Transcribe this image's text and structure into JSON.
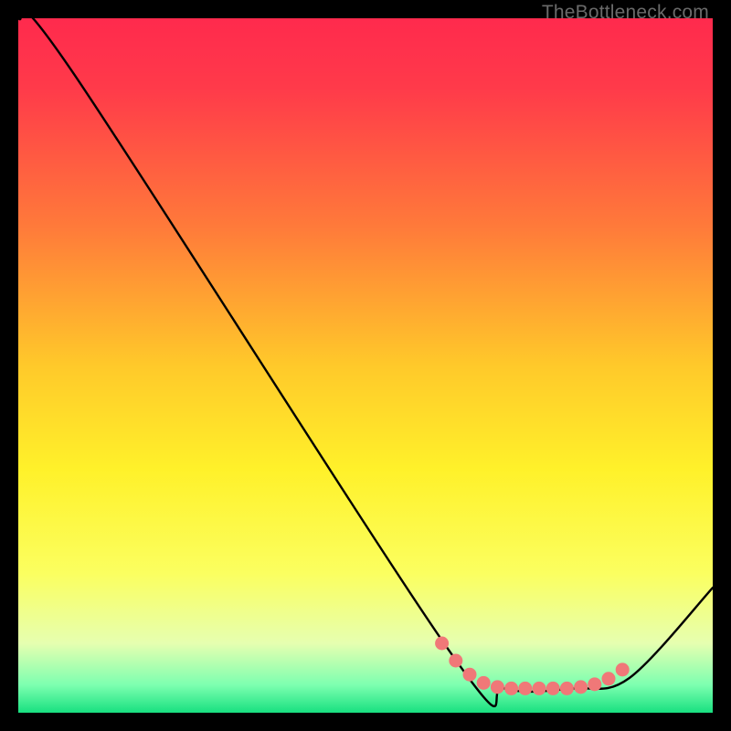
{
  "watermark": "TheBottleneck.com",
  "chart_data": {
    "type": "line",
    "title": "",
    "xlabel": "",
    "ylabel": "",
    "xlim": [
      0,
      100
    ],
    "ylim": [
      0,
      100
    ],
    "series": [
      {
        "name": "bottleneck-curve",
        "x": [
          0,
          8,
          62,
          70,
          80,
          88,
          100
        ],
        "y": [
          100,
          92,
          9,
          3.5,
          3.5,
          5,
          18
        ]
      }
    ],
    "highlight_dots": {
      "name": "optimal-zone-dots",
      "color": "#f07878",
      "x": [
        61,
        63,
        65,
        67,
        69,
        71,
        73,
        75,
        77,
        79,
        81,
        83,
        85,
        87
      ],
      "y": [
        10,
        7.5,
        5.5,
        4.3,
        3.7,
        3.5,
        3.5,
        3.5,
        3.5,
        3.5,
        3.7,
        4.1,
        4.9,
        6.2
      ]
    },
    "gradient_stops": [
      {
        "pos": 0.0,
        "color": "#ff2a4d"
      },
      {
        "pos": 0.1,
        "color": "#ff3a4a"
      },
      {
        "pos": 0.3,
        "color": "#ff7a3a"
      },
      {
        "pos": 0.5,
        "color": "#ffc92a"
      },
      {
        "pos": 0.65,
        "color": "#fff12a"
      },
      {
        "pos": 0.8,
        "color": "#fbff60"
      },
      {
        "pos": 0.9,
        "color": "#e6ffb0"
      },
      {
        "pos": 0.96,
        "color": "#7dffb0"
      },
      {
        "pos": 1.0,
        "color": "#18e080"
      }
    ]
  }
}
